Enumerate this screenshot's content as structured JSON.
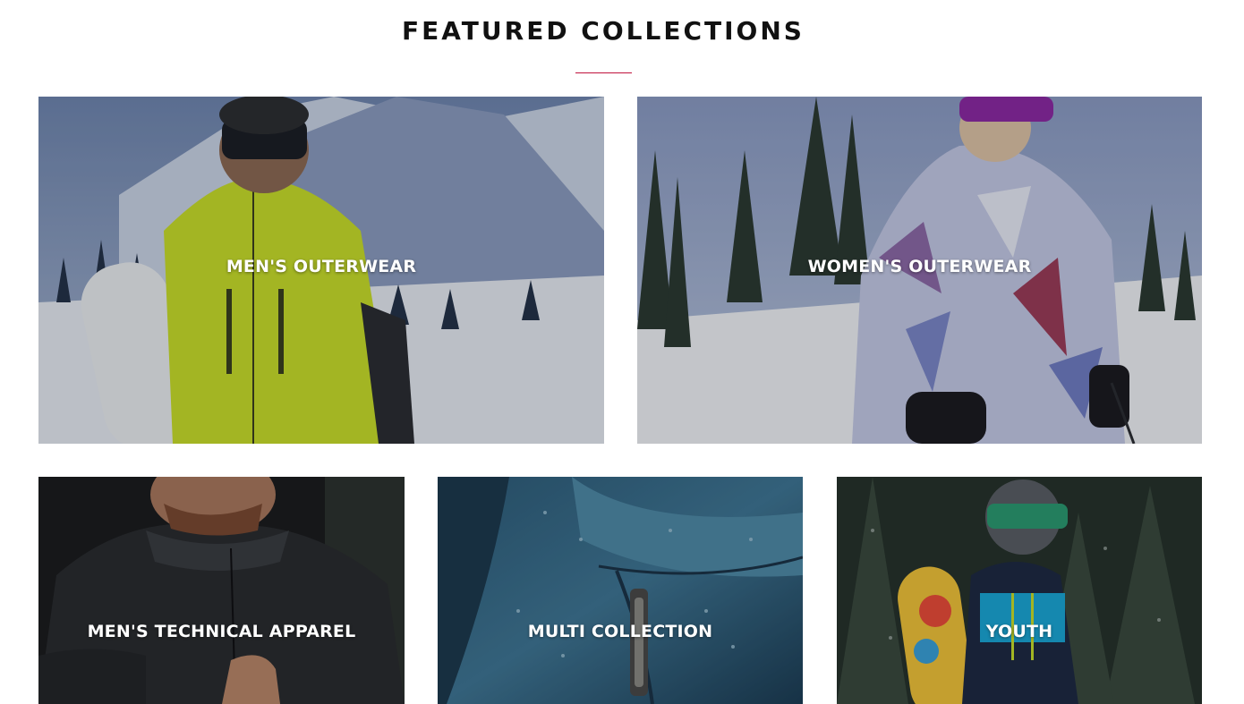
{
  "section": {
    "title": "FEATURED COLLECTIONS",
    "accent_color": "#c0123c"
  },
  "collections": [
    {
      "label": "MEN'S OUTERWEAR"
    },
    {
      "label": "WOMEN'S OUTERWEAR"
    },
    {
      "label": "MEN'S TECHNICAL APPAREL"
    },
    {
      "label": "MULTI COLLECTION"
    },
    {
      "label": "YOUTH"
    }
  ]
}
